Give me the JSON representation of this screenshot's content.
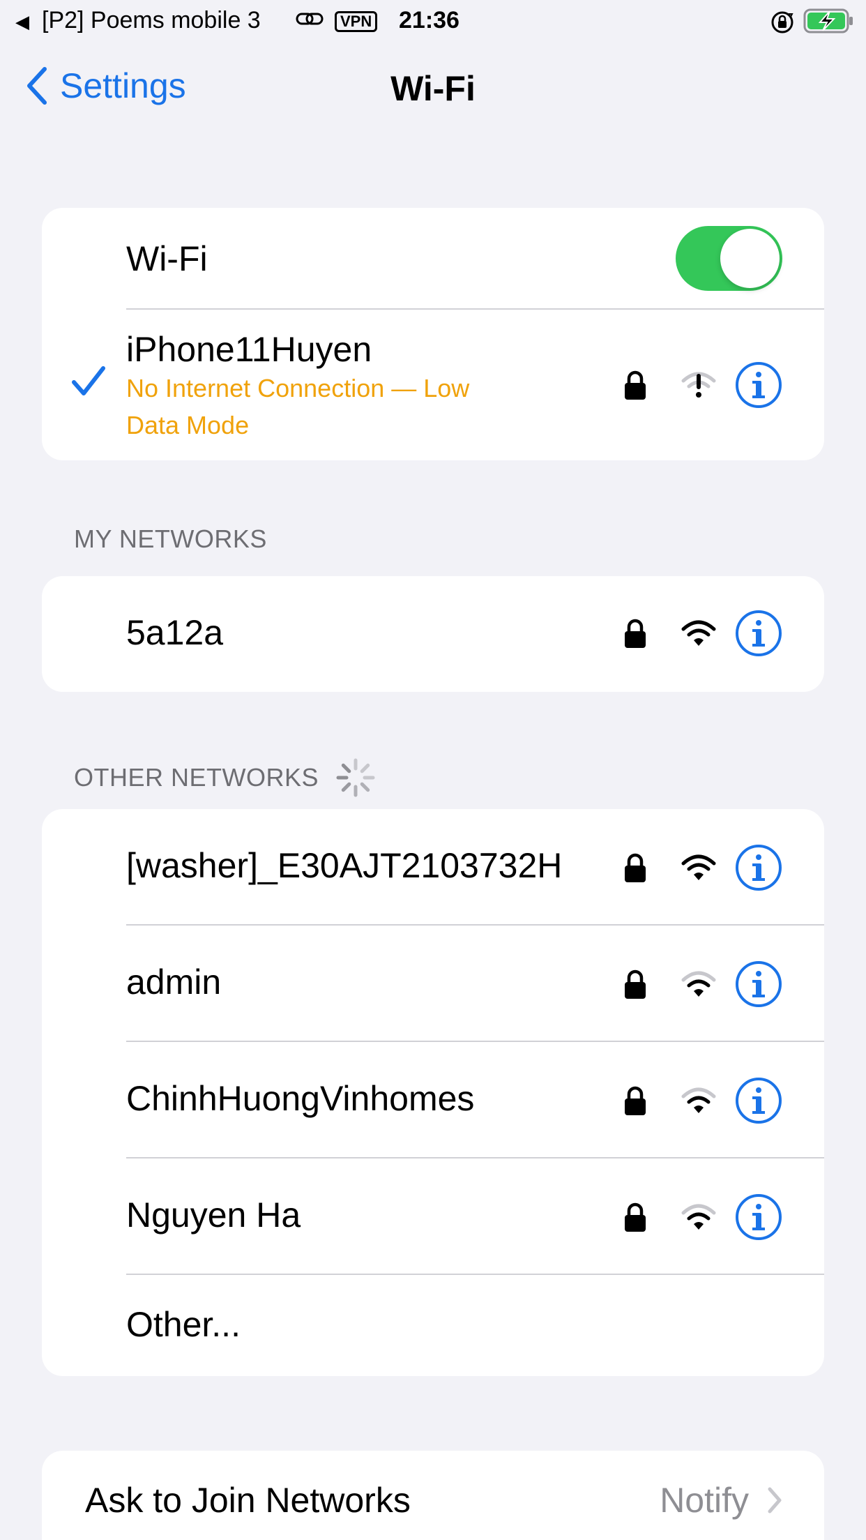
{
  "status_bar": {
    "back_glyph": "◀",
    "carrier": "[P2] Poems mobile 3",
    "vpn": "VPN",
    "time": "21:36",
    "icons": [
      "back-triangle-icon",
      "link-icon",
      "vpn-badge",
      "orientation-lock-icon",
      "battery-charging-icon"
    ]
  },
  "nav": {
    "back_label": "Settings",
    "title": "Wi-Fi"
  },
  "wifi_toggle": {
    "label": "Wi-Fi",
    "on": true
  },
  "connected_network": {
    "name": "iPhone11Huyen",
    "status_line1": "No Internet Connection — Low",
    "status_line2": "Data Mode",
    "secured": true,
    "signal": "no-internet"
  },
  "my_networks": {
    "header": "MY NETWORKS",
    "items": [
      {
        "name": "5a12a",
        "secured": true,
        "signal": "full"
      }
    ]
  },
  "other_networks": {
    "header": "OTHER NETWORKS",
    "items": [
      {
        "name": "[washer]_E30AJT2103732H",
        "secured": true,
        "signal": "full"
      },
      {
        "name": "admin",
        "secured": true,
        "signal": "medium"
      },
      {
        "name": "ChinhHuongVinhomes",
        "secured": true,
        "signal": "medium"
      },
      {
        "name": "Nguyen Ha",
        "secured": true,
        "signal": "medium"
      }
    ],
    "other_label": "Other..."
  },
  "ask_to_join": {
    "label": "Ask to Join Networks",
    "value": "Notify"
  },
  "colors": {
    "accent": "#1a73e8",
    "toggle_on": "#34c759",
    "warning": "#f0a20b",
    "background": "#f2f2f7"
  }
}
